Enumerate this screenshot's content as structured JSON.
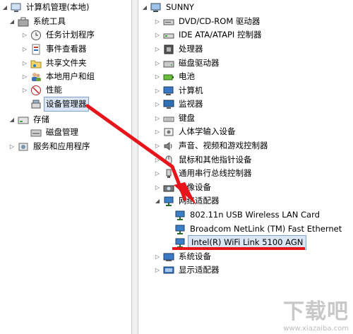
{
  "left_tree": {
    "root": "计算机管理(本地)",
    "system_tools": "系统工具",
    "task_scheduler": "任务计划程序",
    "event_viewer": "事件查看器",
    "shared_folders": "共享文件夹",
    "local_users": "本地用户和组",
    "performance": "性能",
    "device_manager": "设备管理器",
    "storage": "存储",
    "disk_management": "磁盘管理",
    "services_apps": "服务和应用程序"
  },
  "device_tree": {
    "computer_name": "SUNNY",
    "categories": {
      "dvd": "DVD/CD-ROM 驱动器",
      "ide": "IDE ATA/ATAPI 控制器",
      "processor": "处理器",
      "disk": "磁盘驱动器",
      "battery": "电池",
      "computer": "计算机",
      "monitor": "监视器",
      "keyboard": "键盘",
      "hid": "人体学输入设备",
      "sound": "声音、视频和游戏控制器",
      "mouse": "鼠标和其他指针设备",
      "usb": "通用串行总线控制器",
      "imaging": "图像设备",
      "network": "网络适配器",
      "system": "系统设备",
      "display": "显示适配器"
    },
    "network_adapters": [
      "802.11n USB Wireless LAN Card",
      "Broadcom NetLink (TM) Fast Ethernet",
      "Intel(R) WiFi Link 5100 AGN"
    ]
  },
  "watermark": {
    "brand": "下载吧",
    "url": "www.xiazaiba.com"
  },
  "colors": {
    "arrow": "#e8141b",
    "selection": "#dbe6f4"
  }
}
